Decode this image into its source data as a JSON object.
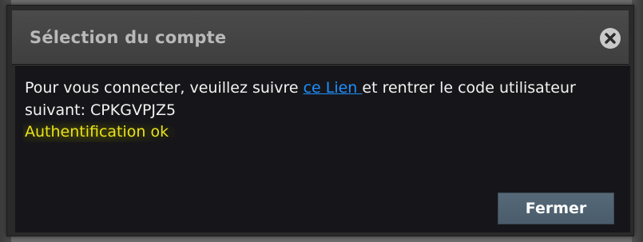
{
  "dialog": {
    "title": "Sélection du compte",
    "close_icon": "close-icon",
    "message": {
      "before_link": "Pour vous connecter, veuillez suivre ",
      "link_text": "ce Lien ",
      "after_link": "et rentrer le code utilisateur suivant: CPKGVPJZ5"
    },
    "auth_status": "Authentification ok",
    "close_button_label": "Fermer"
  },
  "colors": {
    "link": "#1e90ff",
    "auth_status": "#e9e21a",
    "button": "#566978"
  }
}
